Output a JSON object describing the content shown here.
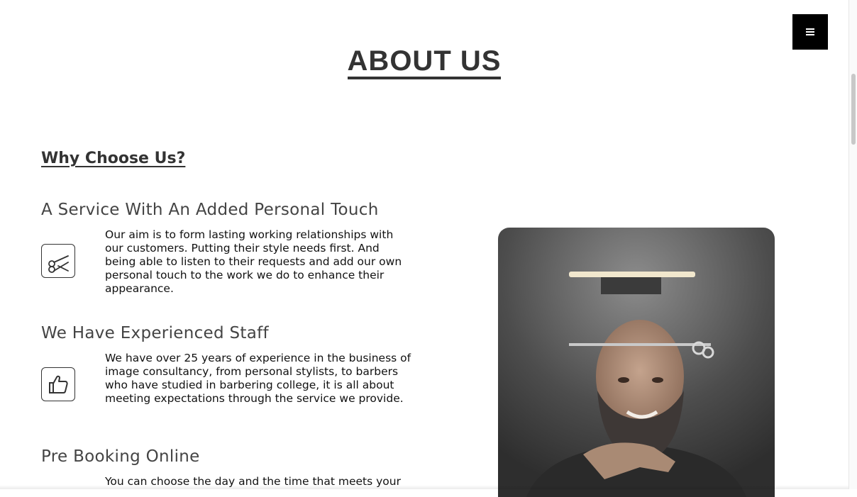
{
  "header": {
    "menu_icon": "menu-icon",
    "title": "ABOUT US"
  },
  "section": {
    "title": "Why Choose Us?"
  },
  "features": [
    {
      "heading": "A Service With An Added Personal Touch",
      "text": "Our aim is to form lasting working relationships with our customers. Putting their style needs first. And being able to listen to their requests and add our own personal touch to the work we do to enhance their appearance.",
      "icon": "scissors-icon"
    },
    {
      "heading": "We Have Experienced Staff",
      "text": "We have over 25 years of experience in the business of image consultancy, from personal stylists, to barbers who have studied in barbering college, it is all about meeting expectations through the service we provide.",
      "icon": "thumbs-up-icon"
    },
    {
      "heading": "Pre Booking Online",
      "text": "You can choose the day and the time that meets your"
    }
  ],
  "image": {
    "subject": "barber-photo"
  },
  "colors": {
    "accent": "#000000",
    "text": "#333333"
  }
}
